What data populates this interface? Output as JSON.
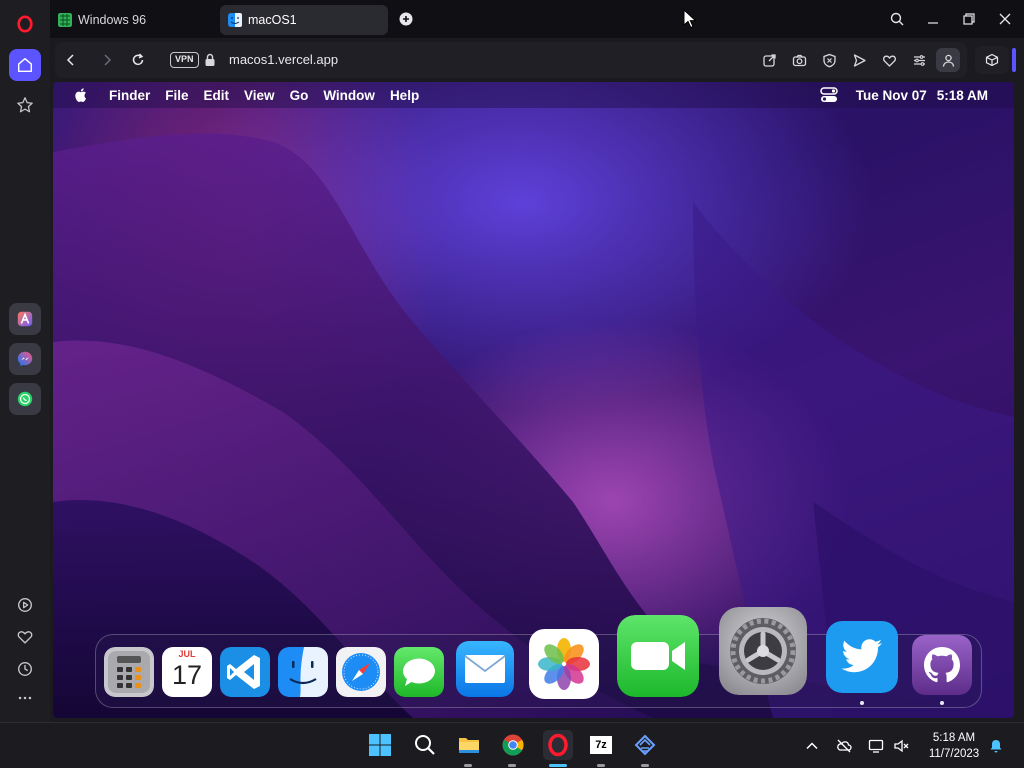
{
  "browser": {
    "tabs": [
      {
        "label": "Windows 96",
        "icon": "windows96-favicon"
      },
      {
        "label": "macOS1",
        "icon": "finder-favicon"
      }
    ],
    "new_tab_icon": "plus-icon",
    "window_controls": [
      "search-icon",
      "minimize-icon",
      "restore-icon",
      "close-icon"
    ],
    "address": {
      "vpn_label": "VPN",
      "url": "macos1.vercel.app"
    },
    "sidebar": {
      "top": [
        "opera-logo",
        "home-icon",
        "star-icon"
      ],
      "apps": [
        "aria-icon",
        "messenger-icon",
        "whatsapp-icon"
      ],
      "bottom": [
        "player-icon",
        "heart-icon",
        "history-icon",
        "more-icon"
      ]
    },
    "accent_color": "#5c54ff"
  },
  "macos": {
    "menubar": {
      "app_name": "Finder",
      "menus": [
        "File",
        "Edit",
        "View",
        "Go",
        "Window",
        "Help"
      ],
      "date": "Tue Nov 07",
      "time": "5:18 AM"
    },
    "calendar_icon": {
      "month": "JUL",
      "day": "17"
    },
    "dock": [
      {
        "app": "Calculator",
        "running": false
      },
      {
        "app": "Calendar",
        "running": false
      },
      {
        "app": "VS Code",
        "running": false
      },
      {
        "app": "Finder",
        "running": false
      },
      {
        "app": "Safari",
        "running": false
      },
      {
        "app": "Messages",
        "running": false
      },
      {
        "app": "Mail",
        "running": false
      },
      {
        "app": "Photos",
        "running": false
      },
      {
        "app": "FaceTime",
        "running": false
      },
      {
        "app": "System Preferences",
        "running": false
      },
      {
        "app": "Twitter",
        "running": true
      },
      {
        "app": "GitHub",
        "running": true
      }
    ]
  },
  "taskbar": {
    "apps": [
      "start-icon",
      "search-icon",
      "file-explorer-icon",
      "chrome-icon",
      "opera-icon",
      "7zip-icon",
      "app-icon"
    ],
    "seven_zip_label": "7z",
    "clock_time": "5:18 AM",
    "clock_date": "11/7/2023"
  }
}
